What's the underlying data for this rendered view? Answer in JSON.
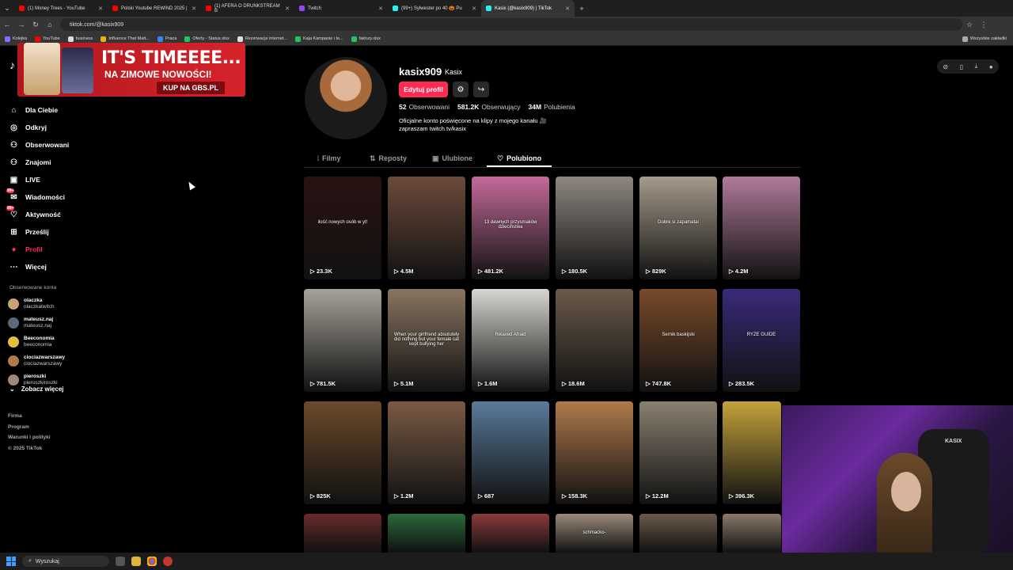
{
  "browser": {
    "tabs": [
      {
        "title": "(1) Money Trees - YouTube",
        "color": "#ff0000"
      },
      {
        "title": "Polski Youtube REWIND 2025 |",
        "color": "#ff0000"
      },
      {
        "title": "(1) AFERA O DRUNKSTREAM B",
        "color": "#ff0000"
      },
      {
        "title": "Twitch",
        "color": "#9146ff"
      },
      {
        "title": "(99+) Sylwester po 40 🎃 Pu",
        "color": "#25f4ee"
      },
      {
        "title": "Kasix (@kasix909) | TikTok",
        "color": "#25f4ee"
      }
    ],
    "url": "tiktok.com/@kasix909",
    "bookmarks": [
      "Kolejka",
      "YouTube",
      "business",
      "Influence That Matt...",
      "Praca",
      "Oferty - Status.xlsx",
      "Rezerwacje internet...",
      "Kaja Kampanie i te...",
      "faktury.xlsx"
    ],
    "all_bookmarks": "Wszystkie zakładki"
  },
  "ad": {
    "title": "IT'S TIMEEEE...",
    "subtitle": "NA ZIMOWE NOWOŚCI!",
    "cta": "KUP NA GBS.PL"
  },
  "sidebar": {
    "logo": "TikTok",
    "items": [
      {
        "label": "Dla Ciebie",
        "icon": "home-icon"
      },
      {
        "label": "Odkryj",
        "icon": "compass-icon"
      },
      {
        "label": "Obserwowani",
        "icon": "following-icon"
      },
      {
        "label": "Znajomi",
        "icon": "friends-icon"
      },
      {
        "label": "LIVE",
        "icon": "live-icon"
      },
      {
        "label": "Wiadomości",
        "icon": "messages-icon",
        "badge": "99+"
      },
      {
        "label": "Aktywność",
        "icon": "activity-icon",
        "badge": "99+"
      },
      {
        "label": "Prześlij",
        "icon": "upload-icon"
      },
      {
        "label": "Profil",
        "icon": "profile-icon"
      },
      {
        "label": "Więcej",
        "icon": "more-icon"
      }
    ],
    "following_title": "Obserwowane konta",
    "following": [
      {
        "name": "olaczka",
        "handle": "olaczkatwitch"
      },
      {
        "name": "mateusz.naj",
        "handle": "mateusz.naj"
      },
      {
        "name": "Beeconomia",
        "handle": "beeconomia"
      },
      {
        "name": "ciociazwarszawy",
        "handle": "ciociazwarszawy"
      },
      {
        "name": "pieroszki",
        "handle": "pieroszkiroszki"
      }
    ],
    "see_more": "Zobacz więcej",
    "footer": [
      "Firma",
      "Program",
      "Warunki i polityki",
      "© 2025 TikTok"
    ]
  },
  "profile": {
    "username": "kasix909",
    "nickname": "Kasix",
    "edit_button": "Edytuj profil",
    "following_count": "52",
    "following_label": "Obserwowani",
    "followers_count": "581.2K",
    "followers_label": "Obserwujący",
    "likes_count": "34M",
    "likes_label": "Polubienia",
    "bio_line1": "Oficjalne konto poświęcone na klipy z mojego kanału 🎥",
    "bio_line2": "zapraszam twitch.tv/kasix"
  },
  "tabs": [
    "Filmy",
    "Reposty",
    "Ulubione",
    "Polubiono"
  ],
  "videos": [
    {
      "views": "23.3K",
      "caption": "ilość nowych osób w yt!",
      "bg": "#2a1212"
    },
    {
      "views": "4.5M",
      "caption": "",
      "bg": "#6a4a3a"
    },
    {
      "views": "481.2K",
      "caption": "13 dawnych przysmaków dzieciństwa",
      "bg": "#c46a9a"
    },
    {
      "views": "180.5K",
      "caption": "",
      "bg": "#8e8780"
    },
    {
      "views": "829K",
      "caption": "Dobre si zapamatai",
      "bg": "#a59a8a"
    },
    {
      "views": "4.2M",
      "caption": "",
      "bg": "#b07a9a"
    },
    {
      "views": "781.5K",
      "caption": "",
      "bg": "#a6a29a"
    },
    {
      "views": "5.1M",
      "caption": "When your girlfriend absolutely did nothing but your female cat kept bullying her",
      "bg": "#8a7560"
    },
    {
      "views": "1.6M",
      "caption": "Relaxed  Afraid",
      "bg": "#d8d6d0"
    },
    {
      "views": "18.6M",
      "caption": "",
      "bg": "#6a5a4a"
    },
    {
      "views": "747.8K",
      "caption": "Sernik baskijski",
      "bg": "#7a4a2a"
    },
    {
      "views": "283.5K",
      "caption": "RYZE GUIDE",
      "bg": "#3a2a7a"
    },
    {
      "views": "825K",
      "caption": "",
      "bg": "#6a4a2a"
    },
    {
      "views": "1.2M",
      "caption": "",
      "bg": "#7a5a45"
    },
    {
      "views": "687",
      "caption": "",
      "bg": "#5a7a9a"
    },
    {
      "views": "158.3K",
      "caption": "",
      "bg": "#b07a4a"
    },
    {
      "views": "12.2M",
      "caption": "",
      "bg": "#8a8070"
    },
    {
      "views": "396.3K",
      "caption": "",
      "bg": "#c4a23a"
    },
    {
      "views": "",
      "caption": "",
      "bg": "#6a2a2a"
    },
    {
      "views": "",
      "caption": "",
      "bg": "#2a6a3a"
    },
    {
      "views": "",
      "caption": "",
      "bg": "#8a3a3a"
    },
    {
      "views": "",
      "caption": "schmacko-",
      "bg": "#9a8a7a"
    },
    {
      "views": "",
      "caption": "",
      "bg": "#6a5a4a"
    },
    {
      "views": "",
      "caption": "",
      "bg": "#8a7a6a"
    }
  ],
  "webcam": {
    "chair_brand": "KASIX"
  },
  "taskbar": {
    "search_placeholder": "Wyszukaj"
  }
}
